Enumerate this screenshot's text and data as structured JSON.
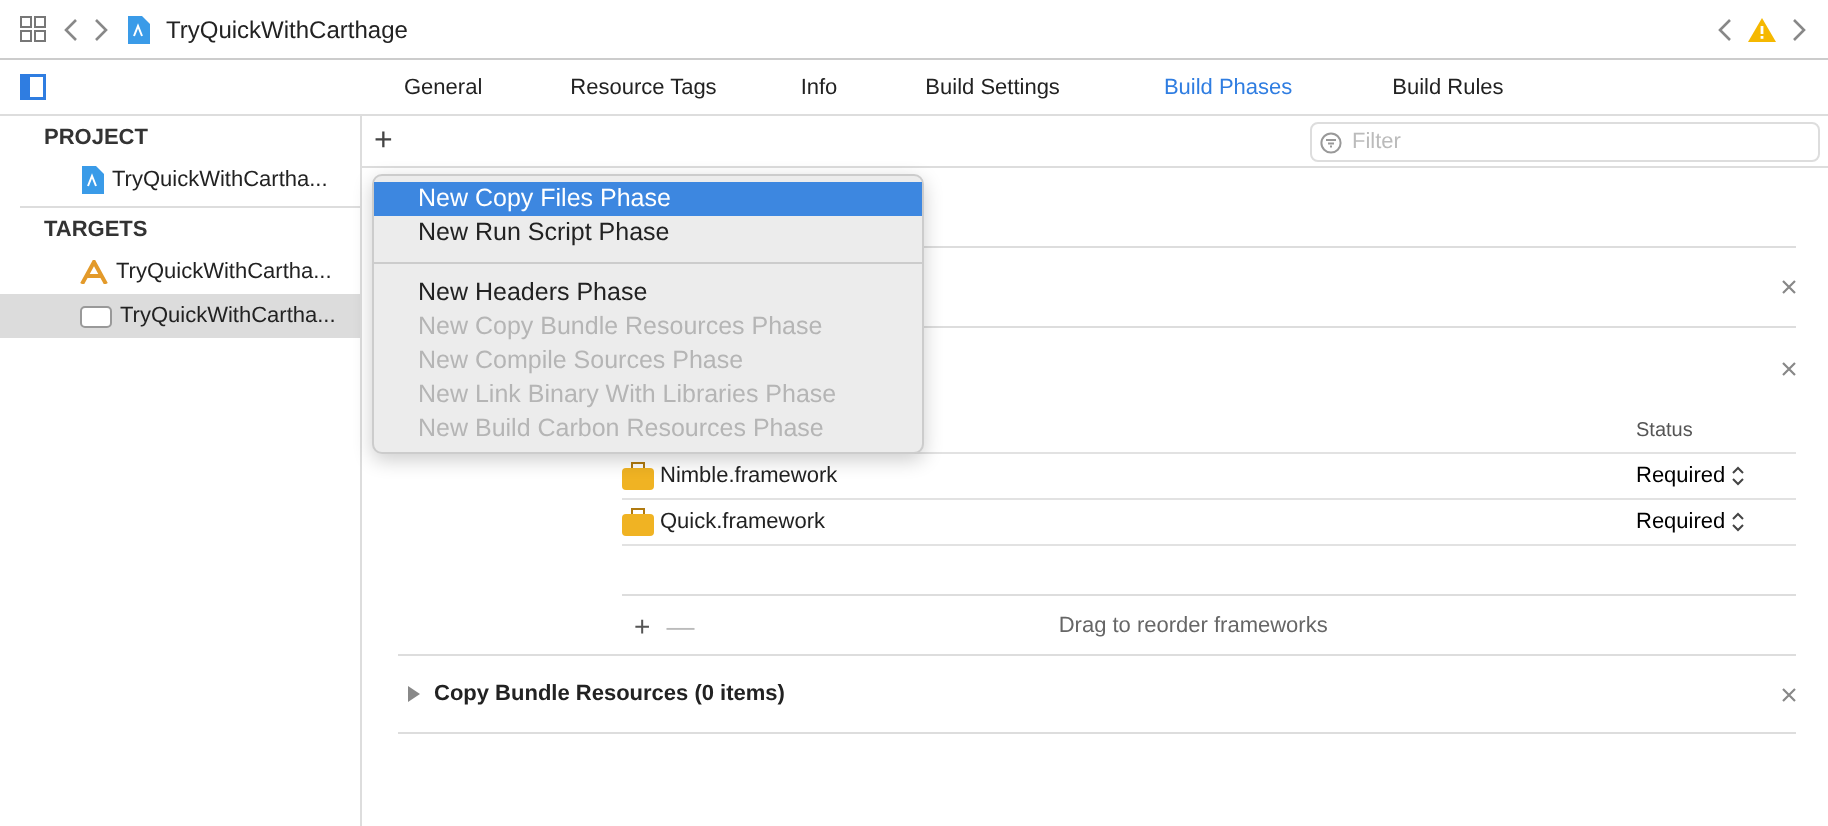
{
  "toolbar": {
    "project_name": "TryQuickWithCarthage"
  },
  "tabs": [
    {
      "label": "General",
      "selected": false
    },
    {
      "label": "Resource Tags",
      "selected": false
    },
    {
      "label": "Info",
      "selected": false
    },
    {
      "label": "Build Settings",
      "selected": false
    },
    {
      "label": "Build Phases",
      "selected": true
    },
    {
      "label": "Build Rules",
      "selected": false
    }
  ],
  "sidebar": {
    "sections": [
      {
        "title": "PROJECT",
        "items": [
          {
            "label": "TryQuickWithCartha...",
            "kind": "project",
            "selected": false
          }
        ]
      },
      {
        "title": "TARGETS",
        "items": [
          {
            "label": "TryQuickWithCartha...",
            "kind": "app",
            "selected": false
          },
          {
            "label": "TryQuickWithCartha...",
            "kind": "test",
            "selected": true
          }
        ]
      }
    ]
  },
  "add_button": "+",
  "filter": {
    "placeholder": "Filter"
  },
  "menu": {
    "items": [
      {
        "label": "New Copy Files Phase",
        "selected": true,
        "disabled": false
      },
      {
        "label": "New Run Script Phase",
        "selected": false,
        "disabled": false
      },
      {
        "kind": "separator"
      },
      {
        "label": "New Headers Phase",
        "selected": false,
        "disabled": false
      },
      {
        "label": "New Copy Bundle Resources Phase",
        "selected": false,
        "disabled": true
      },
      {
        "label": "New Compile Sources Phase",
        "selected": false,
        "disabled": true
      },
      {
        "label": "New Link Binary With Libraries Phase",
        "selected": false,
        "disabled": true
      },
      {
        "label": "New Build Carbon Resources Phase",
        "selected": false,
        "disabled": true
      }
    ]
  },
  "frameworks": {
    "status_header": "Status",
    "rows": [
      {
        "name": "Nimble.framework",
        "status": "Required"
      },
      {
        "name": "Quick.framework",
        "status": "Required"
      }
    ],
    "add": "+",
    "remove": "—",
    "hint": "Drag to reorder frameworks"
  },
  "copy_bundle": {
    "title": "Copy Bundle Resources (0 items)",
    "expanded": false
  }
}
